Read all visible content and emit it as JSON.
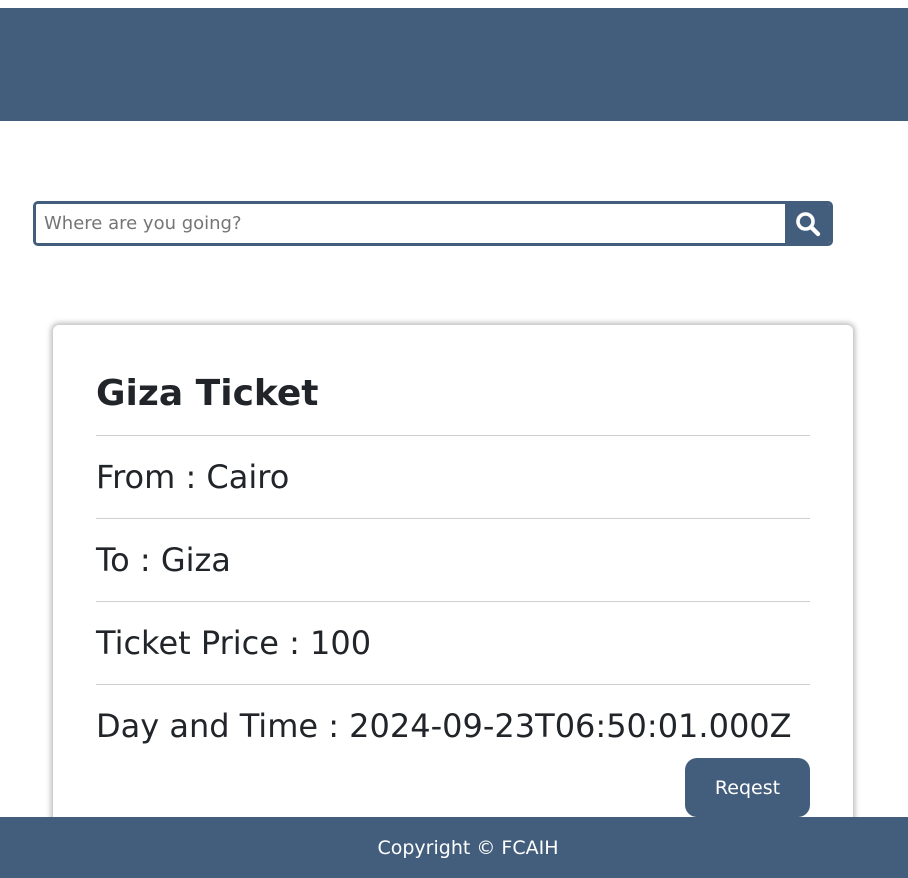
{
  "colors": {
    "primary": "#435e7c",
    "background": "#ffffff",
    "text": "#212529"
  },
  "search": {
    "placeholder": "Where are you going?",
    "value": "",
    "button_icon": "search-icon"
  },
  "ticket": {
    "title": "Giza Ticket",
    "from": "From : Cairo",
    "to": "To : Giza",
    "price": "Ticket Price : 100",
    "day_time": "Day and Time : 2024-09-23T06:50:01.000Z",
    "request_label": "Reqest"
  },
  "footer": {
    "copyright": "Copyright © FCAIH"
  }
}
